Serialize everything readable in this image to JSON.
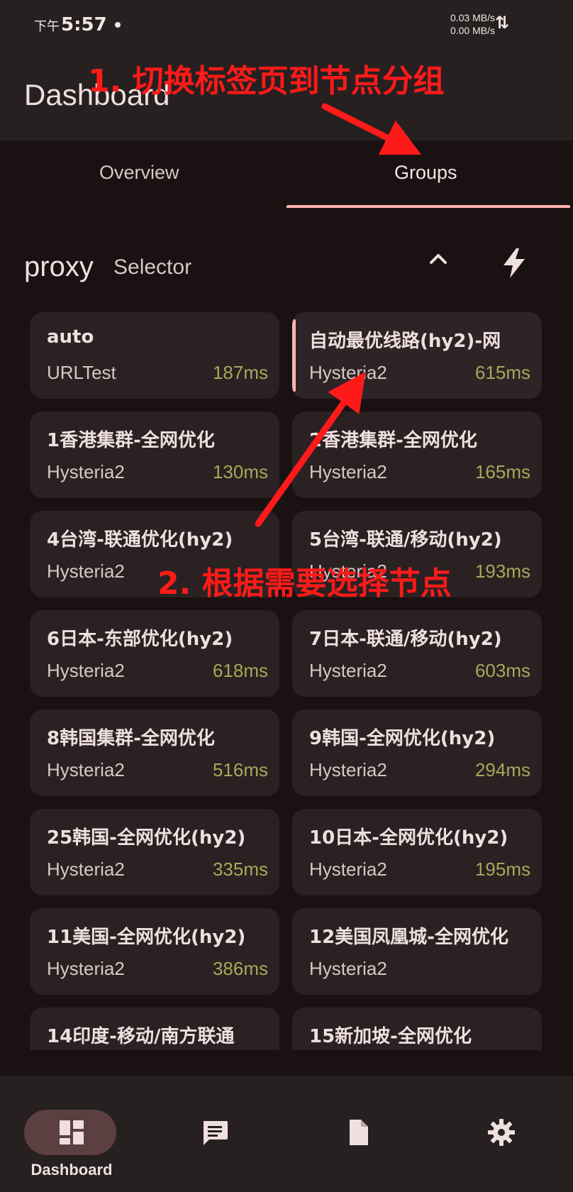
{
  "status_bar": {
    "period": "下午",
    "time": "5:57",
    "upload_speed": "0.03 MB/s",
    "download_speed": "0.00 MB/s"
  },
  "app_bar": {
    "title": "Dashboard"
  },
  "tabs": [
    {
      "label": "Overview",
      "active": false
    },
    {
      "label": "Groups",
      "active": true
    }
  ],
  "group": {
    "name": "proxy",
    "type": "Selector"
  },
  "proxies": [
    {
      "name": "auto",
      "type": "URLTest",
      "delay": "187ms",
      "selected": false
    },
    {
      "name": "自动最优线路(hy2)-网",
      "type": "Hysteria2",
      "delay": "615ms",
      "selected": true
    },
    {
      "name": "1香港集群-全网优化",
      "type": "Hysteria2",
      "delay": "130ms",
      "selected": false
    },
    {
      "name": "2香港集群-全网优化",
      "type": "Hysteria2",
      "delay": "165ms",
      "selected": false
    },
    {
      "name": "4台湾-联通优化(hy2)",
      "type": "Hysteria2",
      "delay": "",
      "selected": false
    },
    {
      "name": "5台湾-联通/移动(hy2)",
      "type": "Hysteria2",
      "delay": "193ms",
      "selected": false
    },
    {
      "name": "6日本-东部优化(hy2)",
      "type": "Hysteria2",
      "delay": "618ms",
      "selected": false
    },
    {
      "name": "7日本-联通/移动(hy2)",
      "type": "Hysteria2",
      "delay": "603ms",
      "selected": false
    },
    {
      "name": "8韩国集群-全网优化",
      "type": "Hysteria2",
      "delay": "516ms",
      "selected": false
    },
    {
      "name": "9韩国-全网优化(hy2)",
      "type": "Hysteria2",
      "delay": "294ms",
      "selected": false
    },
    {
      "name": "25韩国-全网优化(hy2)",
      "type": "Hysteria2",
      "delay": "335ms",
      "selected": false
    },
    {
      "name": "10日本-全网优化(hy2)",
      "type": "Hysteria2",
      "delay": "195ms",
      "selected": false
    },
    {
      "name": "11美国-全网优化(hy2)",
      "type": "Hysteria2",
      "delay": "386ms",
      "selected": false
    },
    {
      "name": "12美国凤凰城-全网优化",
      "type": "Hysteria2",
      "delay": "",
      "selected": false
    },
    {
      "name": "14印度-移动/南方联通",
      "type": "",
      "delay": "",
      "selected": false
    },
    {
      "name": "15新加坡-全网优化",
      "type": "",
      "delay": "",
      "selected": false
    }
  ],
  "bottom_nav": [
    {
      "label": "Dashboard",
      "icon": "dashboard-icon",
      "active": true
    },
    {
      "label": "",
      "icon": "message-icon",
      "active": false
    },
    {
      "label": "",
      "icon": "document-icon",
      "active": false
    },
    {
      "label": "",
      "icon": "gear-icon",
      "active": false
    }
  ],
  "annotations": {
    "step1": "1. 切换标签页到节点分组",
    "step2": "2. 根据需要选择节点",
    "color": "#ff1a1a"
  },
  "colors": {
    "background": "#1a1112",
    "surface": "#272020",
    "card": "#2a2122",
    "accent": "#ffb3b0",
    "delay": "#aaa65a"
  }
}
